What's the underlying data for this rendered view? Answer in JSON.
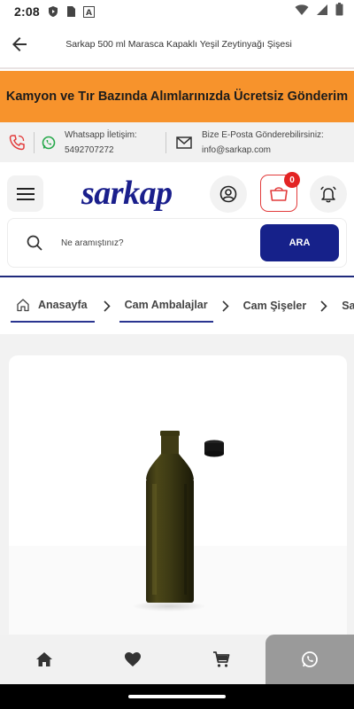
{
  "status_bar": {
    "time": "2:08",
    "left_icons": [
      "shield-play-icon",
      "sim-icon",
      "font-a-icon"
    ],
    "right_icons": [
      "wifi-icon",
      "signal-icon",
      "battery-icon"
    ]
  },
  "app_bar": {
    "back_icon": "arrow-left-icon",
    "title": "Sarkap 500 ml Marasca Kapaklı Yeşil Zeytinyağı Şişesi"
  },
  "promo_banner": {
    "text": "Kamyon ve Tır Bazında Alımlarınızda Ücretsiz Gönderim",
    "color": "#f7932c"
  },
  "contact_bar": {
    "whatsapp_label": "Whatsapp İletişim:",
    "whatsapp_number": "5492707272",
    "email_label": "Bize E-Posta Gönderebilirsiniz:",
    "email": "info@sarkap.com"
  },
  "header": {
    "logo_text": "sarkap",
    "cart_count": "0",
    "brand_color": "#16218a",
    "accent_red": "#e32323"
  },
  "search": {
    "placeholder": "Ne aramıştınız?",
    "button_label": "ARA"
  },
  "breadcrumb": {
    "items": [
      "Anasayfa",
      "Cam Ambalajlar",
      "Cam Şişeler",
      "Sarkap"
    ]
  },
  "product": {
    "image_alt": "Green glass olive oil bottle with black cap"
  },
  "bottom_nav": {
    "items": [
      "home-icon",
      "heart-icon",
      "cart-icon",
      "whatsapp-icon"
    ]
  }
}
